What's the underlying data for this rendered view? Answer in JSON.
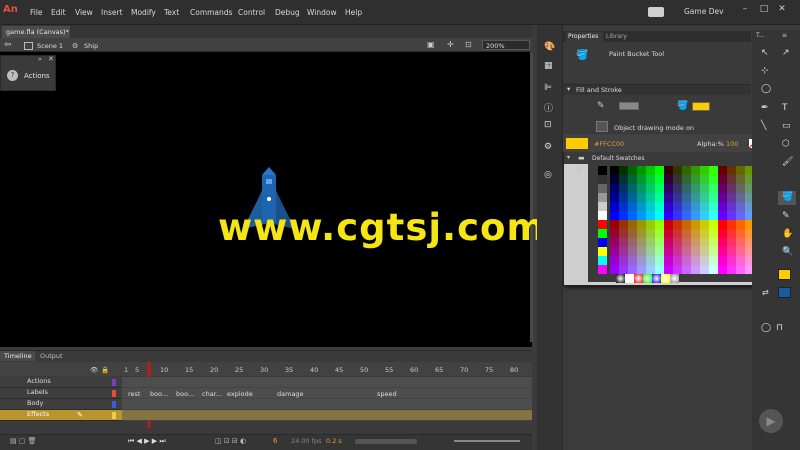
{
  "app": {
    "logo": "An",
    "workspace": "Game Dev"
  },
  "menu": [
    "File",
    "Edit",
    "View",
    "Insert",
    "Modify",
    "Text",
    "Commands",
    "Control",
    "Debug",
    "Window",
    "Help"
  ],
  "document": {
    "tab": "game.fla (Canvas)*",
    "scene": "Scene 1",
    "symbol": "Ship",
    "zoom": "200%"
  },
  "actions_panel": {
    "label": "Actions"
  },
  "watermark": "www.cgtsj.com",
  "timeline": {
    "tabs": [
      "Timeline",
      "Output"
    ],
    "ruler": [
      "1",
      "5",
      "10",
      "15",
      "20",
      "25",
      "30",
      "35",
      "40",
      "45",
      "50",
      "55",
      "60",
      "65",
      "70",
      "75",
      "80"
    ],
    "layers": [
      "Actions",
      "Labels",
      "Body",
      "Effects"
    ],
    "frame_labels": [
      "rest",
      "boo...",
      "boo...",
      "char...",
      "explode",
      "damage",
      "speed"
    ],
    "current_frame": "6",
    "fps": "24.00 fps",
    "time": "0.2 s"
  },
  "properties": {
    "tabs": [
      "Properties",
      "Library"
    ],
    "tool_name": "Paint Bucket Tool",
    "section": "Fill and Stroke",
    "object_drawing": "Object drawing mode on"
  },
  "swatches": {
    "hex": "#FFCC00",
    "alpha_label": "Alpha:%",
    "alpha_value": "100",
    "title": "Default Swatches"
  },
  "colors": {
    "fill": "#FFCC00",
    "accent": "#e0533a",
    "watermark": "#f5e514"
  }
}
